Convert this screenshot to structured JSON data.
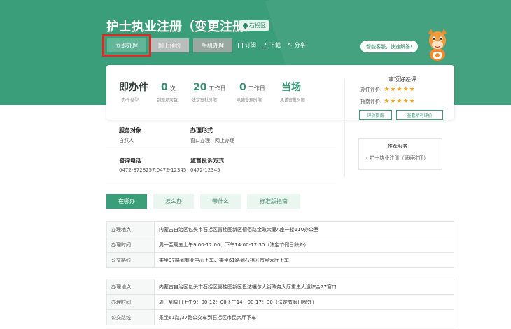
{
  "header": {
    "title": "护士执业注册（变更注册）",
    "region": "石拐区",
    "buttons": {
      "apply": "立即办理",
      "reserve": "网上预约",
      "mobile": "手机办理"
    },
    "tools": {
      "subscribe": "订阅",
      "download": "下载",
      "share": "分享"
    },
    "assistant": "智能客服，快速解答!"
  },
  "stats": [
    {
      "value": "即办件",
      "unit": "",
      "caption": "办件类型"
    },
    {
      "value": "0",
      "unit": "次",
      "caption": "到现场次数"
    },
    {
      "value": "20",
      "unit": "工作日",
      "caption": "法定审批时限"
    },
    {
      "value": "0",
      "unit": "工作日",
      "caption": "承诺受理时限"
    },
    {
      "value": "当场",
      "unit": "",
      "caption": "承诺审批时限"
    }
  ],
  "rating": {
    "title": "事项好差评",
    "rows": [
      {
        "label": "办件评价:",
        "stars": "★★★★★"
      },
      {
        "label": "指南评价:",
        "stars": "★★★★★"
      }
    ],
    "buttons": {
      "evaluate": "评价指南",
      "view_all": "查看所有评价"
    }
  },
  "info": {
    "target_label": "服务对象",
    "target_value": "自然人",
    "form_label": "办理形式",
    "form_value": "窗口办理、网上办理",
    "phone_label": "咨询电话",
    "phone_value": "0472-8728257,0472-12345",
    "complaint_label": "监督投诉方式",
    "complaint_value": "0472-12345"
  },
  "recommend": {
    "title": "推荐服务",
    "item": "• 护士执业注册（延续注册）"
  },
  "tabs": [
    "在哪办",
    "怎么办",
    "带什么",
    "标准版指南"
  ],
  "locations": [
    {
      "rows": [
        {
          "label": "办理地点",
          "value": "内蒙古自治区包头市石拐区喜桂图新区德佰路金政大厦A座一楼110办公室"
        },
        {
          "label": "办理时间",
          "value": "周一至周五上午9:00-12:00、下午14:00-17:30（法定节假日除外）"
        },
        {
          "label": "公交路线",
          "value": "乘坐37路到商业中心下车、乘坐61路到石拐区市民大厅下车"
        }
      ]
    },
    {
      "rows": [
        {
          "label": "办理地点",
          "value": "内蒙古自治区包头市石拐区喜桂图新区巴达嘎尔大街政务大厅重生大道综合27窗口"
        },
        {
          "label": "办理时间",
          "value": "周一到周日上午9：00-12：00下午14：00-17：30（法定节假日除外）"
        },
        {
          "label": "公交路线",
          "value": "乘坐61路/37路公交车到石拐区市民大厅下车"
        }
      ]
    }
  ],
  "colors": {
    "brand": "#3a9e7b",
    "highlight": "#e32626",
    "star": "#f5a623"
  }
}
